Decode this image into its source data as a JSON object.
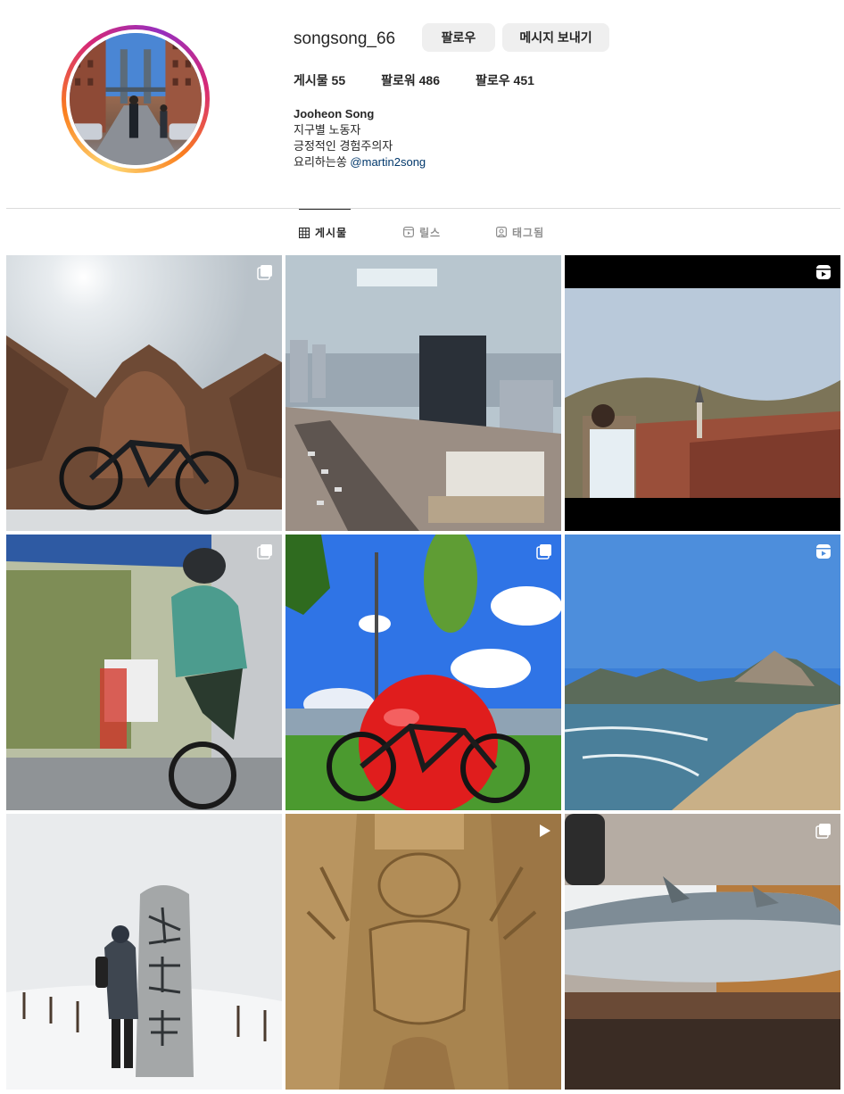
{
  "profile": {
    "username": "songsong_66",
    "follow_label": "팔로우",
    "message_label": "메시지 보내기",
    "stats": {
      "posts": "게시물 55",
      "followers": "팔로워 486",
      "following": "팔로우 451"
    },
    "bio": {
      "name": "Jooheon Song",
      "line1": "지구별 노동자",
      "line2": "긍정적인 경험주의자",
      "line3_prefix": "요리하는쏭 ",
      "mention": "@martin2song"
    }
  },
  "tabs": [
    {
      "label": "게시물",
      "icon": "grid-icon",
      "active": true
    },
    {
      "label": "릴스",
      "icon": "reels-icon",
      "active": false
    },
    {
      "label": "태그됨",
      "icon": "tagged-icon",
      "active": false
    }
  ],
  "posts": [
    {
      "subject": "bike-with-monster-statue",
      "badge": "carousel-icon"
    },
    {
      "subject": "city-construction-view",
      "badge": ""
    },
    {
      "subject": "man-overlooking-old-town",
      "badge": "reels-icon"
    },
    {
      "subject": "cyclist-racing",
      "badge": "carousel-icon"
    },
    {
      "subject": "bike-with-red-apple",
      "badge": "carousel-icon"
    },
    {
      "subject": "beach-mountains",
      "badge": "reels-icon"
    },
    {
      "subject": "hiker-snow-summit-stone",
      "badge": ""
    },
    {
      "subject": "egyptian-relief-closeup",
      "badge": "video-icon"
    },
    {
      "subject": "fish-on-cutting-board",
      "badge": "carousel-icon"
    }
  ],
  "colors": {
    "accent_link": "#00376b",
    "button_bg": "#efefef",
    "text": "#262626",
    "muted": "#8e8e8e",
    "divider": "#dbdbdb"
  }
}
